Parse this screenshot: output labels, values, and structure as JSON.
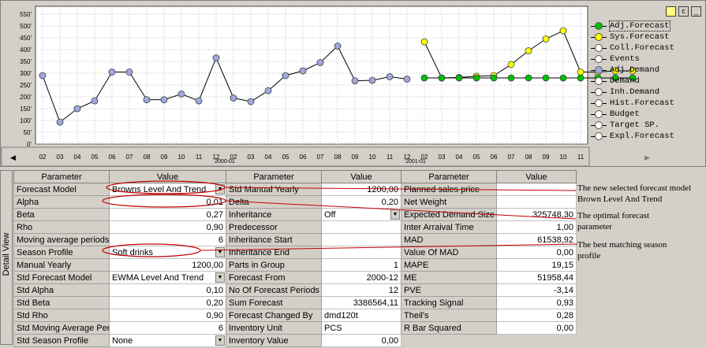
{
  "chart_data": {
    "type": "line",
    "y_ticks": [
      "0'",
      "50'",
      "100'",
      "150'",
      "200'",
      "250'",
      "300'",
      "350'",
      "400'",
      "450'",
      "500'",
      "550'"
    ],
    "ylim": [
      0,
      550
    ],
    "x_ticks": [
      "02",
      "03",
      "04",
      "05",
      "06",
      "07",
      "08",
      "09",
      "10",
      "11",
      "12",
      "02",
      "03",
      "04",
      "05",
      "06",
      "07",
      "08",
      "09",
      "10",
      "11",
      "12",
      "02",
      "03",
      "04",
      "05",
      "06",
      "07",
      "08",
      "09",
      "10",
      "11"
    ],
    "year_labels": [
      "2000-01",
      "2001-01"
    ],
    "series": [
      {
        "name": "Adj.Demand",
        "color": "#a0a8e0",
        "start_index": 0,
        "values": [
          290,
          93,
          150,
          183,
          305,
          305,
          188,
          188,
          212,
          183,
          365,
          195,
          180,
          226,
          290,
          310,
          345,
          415,
          268,
          270,
          285,
          275
        ]
      },
      {
        "name": "Sys.Forecast",
        "color": "#ffff00",
        "start_index": 22,
        "values": [
          433,
          280,
          282,
          287,
          290,
          337,
          395,
          445,
          480,
          305,
          305,
          310,
          310
        ]
      },
      {
        "name": "Adj.Forecast",
        "color": "#00c000",
        "start_index": 22,
        "values": [
          280,
          280,
          280,
          280,
          280,
          280,
          280,
          280,
          280,
          280,
          280,
          280,
          280
        ]
      }
    ],
    "grid": true,
    "legend": "right"
  },
  "legend": [
    {
      "label": "Adj.Forecast",
      "color": "#00c000",
      "selected": true
    },
    {
      "label": "Sys.Forecast",
      "color": "#ffff00"
    },
    {
      "label": "Coll.Forecast",
      "color": "#ffffff"
    },
    {
      "label": "Events",
      "color": "#ffffff"
    },
    {
      "label": "Adj.Demand",
      "color": "#a0a8e0"
    },
    {
      "label": "Demand",
      "color": "#ffffff"
    },
    {
      "label": "Inh.Demand",
      "color": "#ffffff"
    },
    {
      "label": "Hist.Forecast",
      "color": "#ffffff"
    },
    {
      "label": "Budget",
      "color": "#ffffff"
    },
    {
      "label": "Target SP.",
      "color": "#ffffff"
    },
    {
      "label": "Expl.Forecast",
      "color": "#ffffff"
    }
  ],
  "window_buttons": [
    "c",
    "_"
  ],
  "side_tab": "Detail View",
  "headers": {
    "param": "Parameter",
    "value": "Value"
  },
  "col1": [
    {
      "p": "Forecast Model",
      "v": "Browns Level And Trend",
      "dd": true
    },
    {
      "p": "Alpha",
      "v": "0,01"
    },
    {
      "p": "Beta",
      "v": "0,27"
    },
    {
      "p": "Rho",
      "v": "0,90"
    },
    {
      "p": "Moving average periods",
      "v": "6"
    },
    {
      "p": "Season Profile",
      "v": "Soft drinks",
      "dd": true
    },
    {
      "p": "Manual Yearly",
      "v": "1200,00"
    },
    {
      "p": "Std Forecast Model",
      "v": "EWMA Level And Trend",
      "dd": true
    },
    {
      "p": "Std Alpha",
      "v": "0,10"
    },
    {
      "p": "Std Beta",
      "v": "0,20"
    },
    {
      "p": "Std Rho",
      "v": "0,90"
    },
    {
      "p": "Std Moving Average Per",
      "v": "6"
    },
    {
      "p": "Std Season Profile",
      "v": "None",
      "dd": true
    }
  ],
  "col2": [
    {
      "p": "Std Manual Yearly",
      "v": "1200,00"
    },
    {
      "p": "Delta",
      "v": "0,20"
    },
    {
      "p": "Inheritance",
      "v": "Off",
      "dd": true
    },
    {
      "p": "Predecessor",
      "v": ""
    },
    {
      "p": "Inheritance Start",
      "v": ""
    },
    {
      "p": "Inheritance End",
      "v": ""
    },
    {
      "p": "Parts in Group",
      "v": "1"
    },
    {
      "p": "Forecast From",
      "v": "2000-12"
    },
    {
      "p": "No Of Forecast Periods",
      "v": "12"
    },
    {
      "p": "Sum Forecast",
      "v": "3386564,11"
    },
    {
      "p": "Forecast Changed By",
      "v": "dmd120t"
    },
    {
      "p": "Inventory Unit",
      "v": "PCS"
    },
    {
      "p": "Inventory Value",
      "v": "0,00"
    }
  ],
  "col3": [
    {
      "p": "Planned sales price",
      "v": ""
    },
    {
      "p": "Net Weight",
      "v": ""
    },
    {
      "p": "Expected Demand Size",
      "v": "325748,30"
    },
    {
      "p": "Inter Arraival Time",
      "v": "1,00"
    },
    {
      "p": "MAD",
      "v": "61538,92"
    },
    {
      "p": "Value Of MAD",
      "v": "0,00"
    },
    {
      "p": "MAPE",
      "v": "19,15"
    },
    {
      "p": "ME",
      "v": "51958,44"
    },
    {
      "p": "PVE",
      "v": "-3,14"
    },
    {
      "p": "Tracking Signal",
      "v": "0,93"
    },
    {
      "p": "Theil's",
      "v": "0,28"
    },
    {
      "p": "R Bar Squared",
      "v": "0,00"
    }
  ],
  "annotations": [
    "The new selected forecast model Brown Level And Trend",
    "The optimal forecast parameter",
    "The best matching season profile"
  ]
}
